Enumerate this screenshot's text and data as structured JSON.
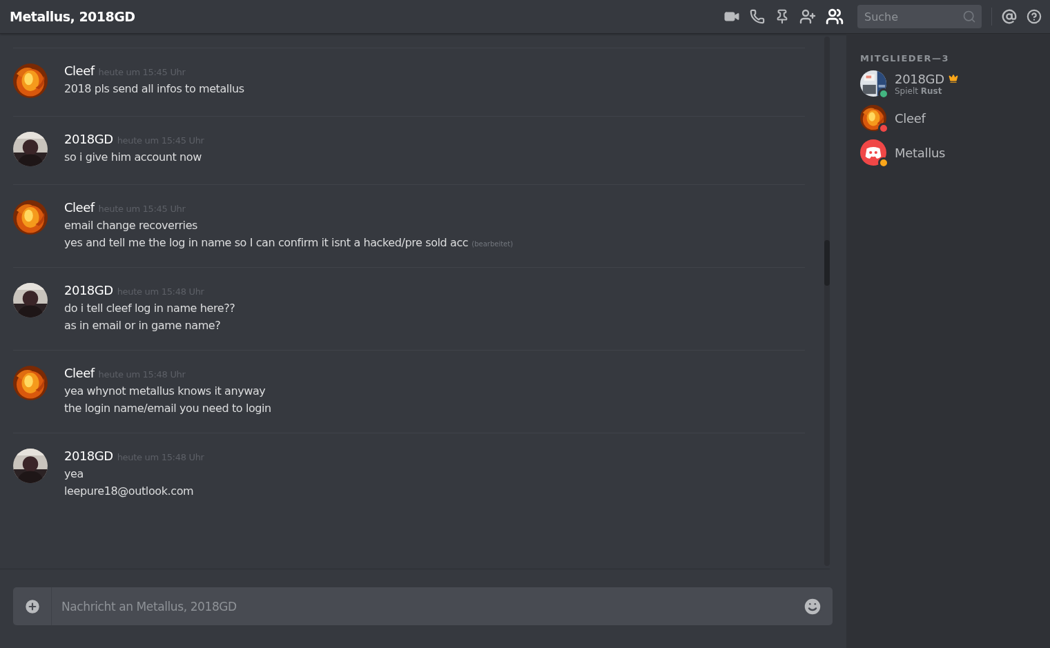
{
  "window": {
    "title": "Metallus, 2018GD"
  },
  "search": {
    "placeholder": "Suche"
  },
  "messages": [
    {
      "author": "Cleef",
      "timestamp": "heute um 15:45 Uhr",
      "lines": [
        {
          "text": "2018 pls send all infos to metallus"
        }
      ]
    },
    {
      "author": "2018GD",
      "timestamp": "heute um 15:45 Uhr",
      "lines": [
        {
          "text": "so i give him account now"
        }
      ]
    },
    {
      "author": "Cleef",
      "timestamp": "heute um 15:45 Uhr",
      "lines": [
        {
          "text": "email change recoverries"
        },
        {
          "text": "yes and tell me the log in name so I can confirm it isnt a hacked/pre sold acc",
          "edited_tag": "(bearbeitet)"
        }
      ]
    },
    {
      "author": "2018GD",
      "timestamp": "heute um 15:48 Uhr",
      "lines": [
        {
          "text": "do i tell cleef log in name here??"
        },
        {
          "text": "as in email or in game name?"
        }
      ]
    },
    {
      "author": "Cleef",
      "timestamp": "heute um 15:48 Uhr",
      "lines": [
        {
          "text": "yea whynot metallus knows it anyway"
        },
        {
          "text": "the login name/email you need to login"
        }
      ]
    },
    {
      "author": "2018GD",
      "timestamp": "heute um 15:48 Uhr",
      "lines": [
        {
          "text": "yea"
        },
        {
          "text": "leepure18@outlook.com"
        }
      ]
    }
  ],
  "composer": {
    "placeholder": "Nachricht an Metallus, 2018GD"
  },
  "members": {
    "heading": "MITGLIEDER—3",
    "items": [
      {
        "name": "2018GD",
        "color": "#43b581",
        "owner": true,
        "activity": "Spielt **Rust**"
      },
      {
        "name": "Cleef",
        "color": "#f04747",
        "owner": false
      },
      {
        "name": "Metallus",
        "color": "#faa61a",
        "owner": false
      }
    ]
  }
}
